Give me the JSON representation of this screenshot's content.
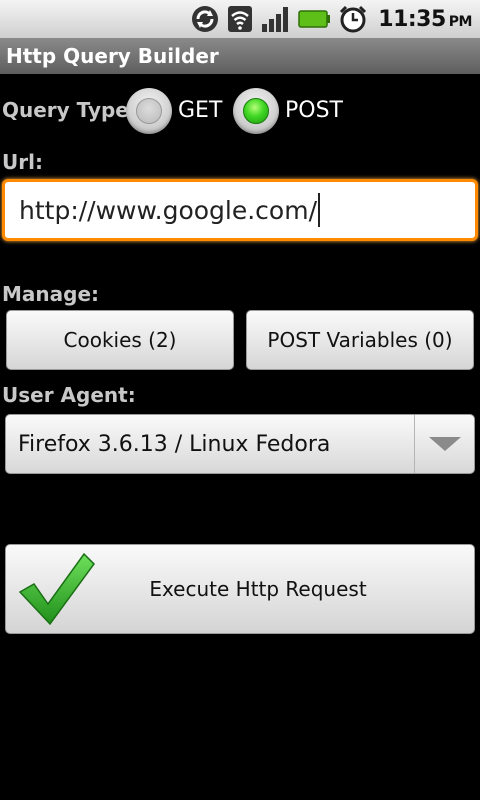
{
  "status_bar": {
    "time": "11:35",
    "ampm": "PM",
    "icons": [
      "sync-icon",
      "wifi-icon",
      "signal-icon",
      "battery-icon",
      "alarm-icon"
    ]
  },
  "app": {
    "title": "Http Query Builder"
  },
  "query_type": {
    "label": "Query Type:",
    "options": [
      {
        "label": "GET",
        "selected": false
      },
      {
        "label": "POST",
        "selected": true
      }
    ]
  },
  "url": {
    "label": "Url:",
    "value": "http://www.google.com/"
  },
  "manage": {
    "label": "Manage:",
    "cookies_button": "Cookies (2)",
    "post_variables_button": "POST Variables (0)"
  },
  "user_agent": {
    "label": "User Agent:",
    "selected": "Firefox 3.6.13 / Linux Fedora"
  },
  "execute": {
    "label": "Execute Http Request"
  },
  "colors": {
    "focus_border": "#ff8a00",
    "radio_selected": "#3fd624",
    "check_green": "#2fb52a"
  }
}
